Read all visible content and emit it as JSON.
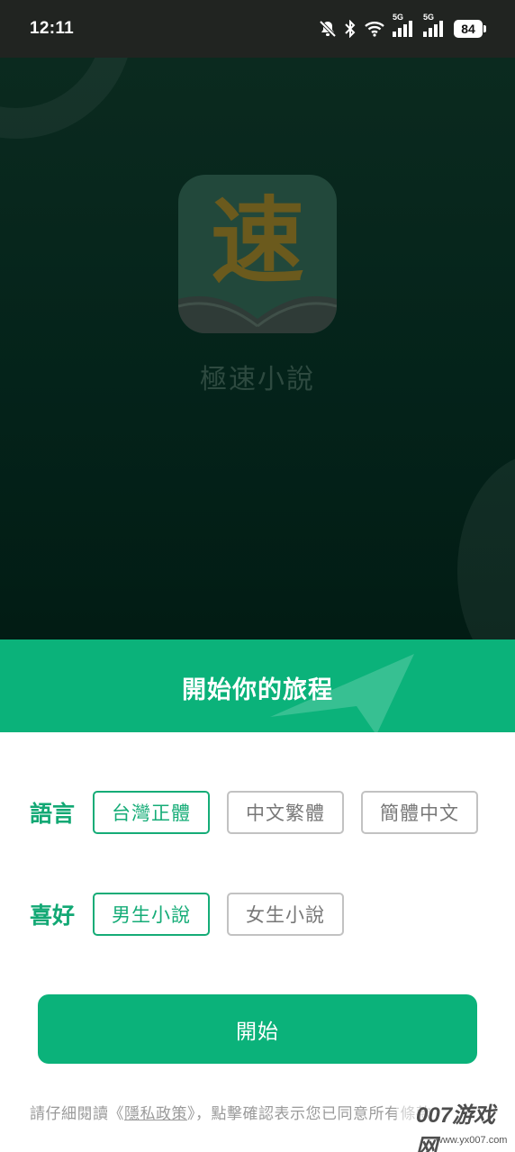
{
  "status_bar": {
    "time": "12:11",
    "signal1_label": "5G",
    "signal2_label": "5G",
    "battery": "84",
    "icons": [
      "bell-muted-icon",
      "bluetooth-icon",
      "wifi-icon",
      "signal-icon",
      "signal-icon",
      "battery-icon"
    ]
  },
  "splash": {
    "app_name": "極速小說",
    "logo_char": "速"
  },
  "banner": {
    "title": "開始你的旅程"
  },
  "language": {
    "label": "語言",
    "options": [
      {
        "label": "台灣正體",
        "selected": true
      },
      {
        "label": "中文繁體",
        "selected": false
      },
      {
        "label": "簡體中文",
        "selected": false
      }
    ]
  },
  "preference": {
    "label": "喜好",
    "options": [
      {
        "label": "男生小說",
        "selected": true
      },
      {
        "label": "女生小說",
        "selected": false
      }
    ]
  },
  "start_button": {
    "label": "開始"
  },
  "footer": {
    "prefix": "請仔細閱讀《",
    "link": "隱私政策",
    "suffix": "》，點擊確認表示您已同意所有條款"
  },
  "watermark": {
    "main": "007游戏网",
    "url": "www.yx007.com"
  },
  "colors": {
    "accent": "#0bb27a",
    "splash_bg": "#04231a",
    "chip_unselected": "#c2c2c2"
  }
}
